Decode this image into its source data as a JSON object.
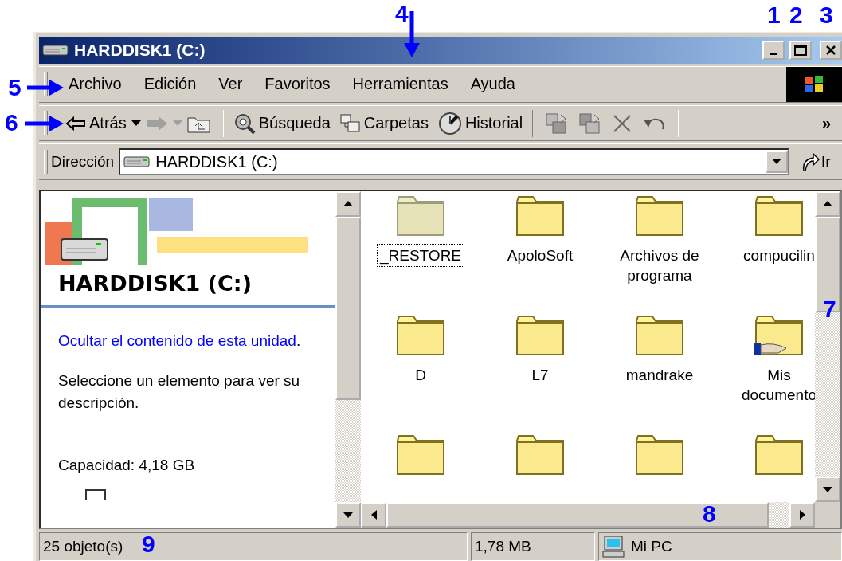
{
  "window": {
    "title": "HARDDISK1 (C:)"
  },
  "menu": [
    {
      "label": "Archivo"
    },
    {
      "label": "Edición"
    },
    {
      "label": "Ver"
    },
    {
      "label": "Favoritos"
    },
    {
      "label": "Herramientas"
    },
    {
      "label": "Ayuda"
    }
  ],
  "toolbar": {
    "back": {
      "label": "Atrás",
      "disabled": false
    },
    "forward": {
      "disabled": true
    },
    "buttons": [
      {
        "kind": "search",
        "label": "Búsqueda"
      },
      {
        "kind": "folders",
        "label": "Carpetas"
      },
      {
        "kind": "history",
        "label": "Historial"
      }
    ],
    "more": "»"
  },
  "address_bar": {
    "label": "Dirección",
    "value": "HARDDISK1 (C:)",
    "go": "Ir"
  },
  "left_pane": {
    "title": "HARDDISK1 (C:)",
    "link": "Ocultar el contenido de esta unidad",
    "link_after": ".",
    "description": "Seleccione un elemento para ver su descripción.",
    "capacity": "Capacidad: 4,18 GB"
  },
  "folders": [
    {
      "name": "_RESTORE",
      "hidden": true,
      "focused": true,
      "shared": false
    },
    {
      "name": "ApoloSoft",
      "hidden": false,
      "focused": false,
      "shared": false
    },
    {
      "name": "Archivos de programa",
      "hidden": false,
      "focused": false,
      "shared": false
    },
    {
      "name": "compucilin",
      "hidden": false,
      "focused": false,
      "shared": false
    },
    {
      "name": "D",
      "hidden": false,
      "focused": false,
      "shared": false
    },
    {
      "name": "L7",
      "hidden": false,
      "focused": false,
      "shared": false
    },
    {
      "name": "mandrake",
      "hidden": false,
      "focused": false,
      "shared": false
    },
    {
      "name": "Mis documento",
      "hidden": false,
      "focused": false,
      "shared": true
    },
    {
      "hidden": false,
      "shared": false
    },
    {
      "hidden": false,
      "shared": false
    },
    {
      "hidden": false,
      "shared": false
    },
    {
      "hidden": false,
      "shared": false
    }
  ],
  "status_bar": {
    "objects": "25 objeto(s)",
    "size": "1,78 MB",
    "zone": "Mi PC"
  },
  "annotations": [
    {
      "label": "4",
      "kind": "arrow_down"
    },
    {
      "label": "1",
      "kind": "plain"
    },
    {
      "label": "2",
      "kind": "plain"
    },
    {
      "label": "3",
      "kind": "plain"
    },
    {
      "label": "5",
      "kind": "arrow_right"
    },
    {
      "label": "6",
      "kind": "arrow_right"
    },
    {
      "label": "7",
      "kind": "plain"
    },
    {
      "label": "8",
      "kind": "plain"
    },
    {
      "label": "9",
      "kind": "plain"
    }
  ]
}
